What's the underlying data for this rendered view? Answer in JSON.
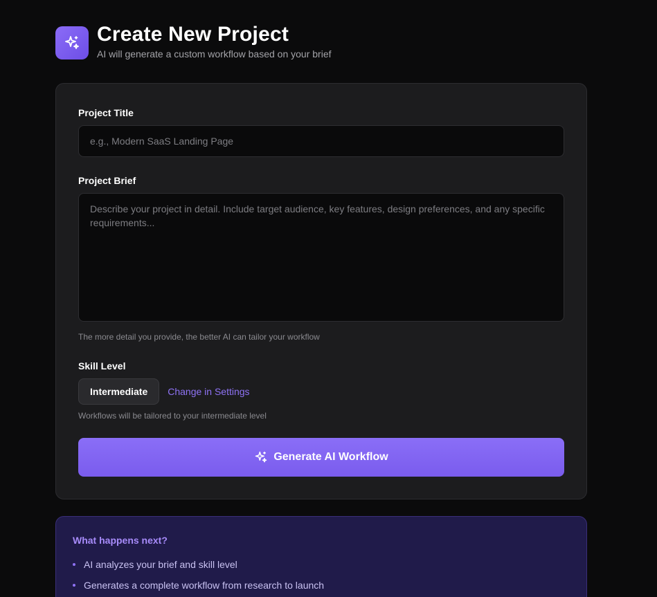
{
  "header": {
    "icon": "sparkles-icon",
    "title": "Create New Project",
    "subtitle": "AI will generate a custom workflow based on your brief"
  },
  "form": {
    "title_label": "Project Title",
    "title_placeholder": "e.g., Modern SaaS Landing Page",
    "title_value": "",
    "brief_label": "Project Brief",
    "brief_placeholder": "Describe your project in detail. Include target audience, key features, design preferences, and any specific requirements...",
    "brief_value": "",
    "brief_helper": "The more detail you provide, the better AI can tailor your workflow",
    "skill_label": "Skill Level",
    "skill_value": "Intermediate",
    "skill_link": "Change in Settings",
    "skill_helper": "Workflows will be tailored to your intermediate level",
    "generate_label": "Generate AI Workflow",
    "generate_icon": "sparkles-icon"
  },
  "info": {
    "title": "What happens next?",
    "items": [
      "AI analyzes your brief and skill level",
      "Generates a complete workflow from research to launch"
    ]
  },
  "colors": {
    "background": "#0b0b0c",
    "card": "#1c1c1e",
    "accent": "#8a6ef7",
    "info_card": "#201b4a"
  }
}
